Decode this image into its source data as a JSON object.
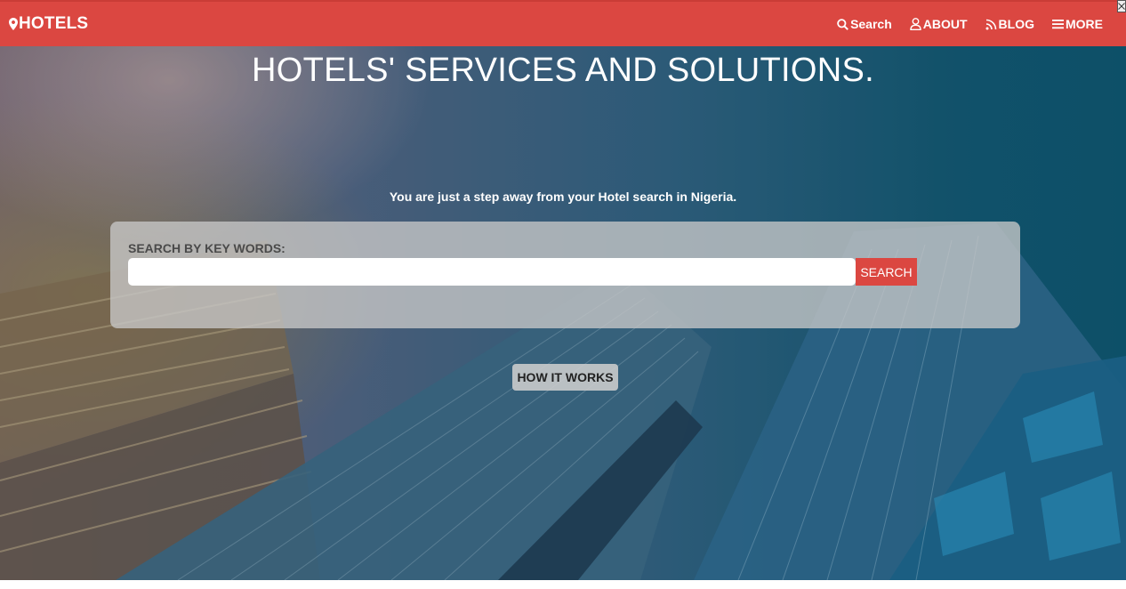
{
  "navbar": {
    "brand": "HOTELS",
    "brand_icon": "map-pin-icon",
    "items": [
      {
        "label": "Search",
        "icon": "search-icon"
      },
      {
        "label": "ABOUT",
        "icon": "user-icon"
      },
      {
        "label": "BLOG",
        "icon": "rss-icon"
      },
      {
        "label": "MORE",
        "icon": "menu-icon"
      }
    ]
  },
  "hero": {
    "headline": "HOTELS' SERVICES AND SOLUTIONS.",
    "tagline": "You are just a step away from your Hotel search in Nigeria."
  },
  "search": {
    "label": "SEARCH BY KEY WORDS:",
    "value": "",
    "placeholder": "",
    "button_label": "SEARCH"
  },
  "how_it_works": {
    "label": "HOW IT WORKS"
  },
  "colors": {
    "brand_red": "#db4741",
    "text_white": "#ffffff"
  }
}
